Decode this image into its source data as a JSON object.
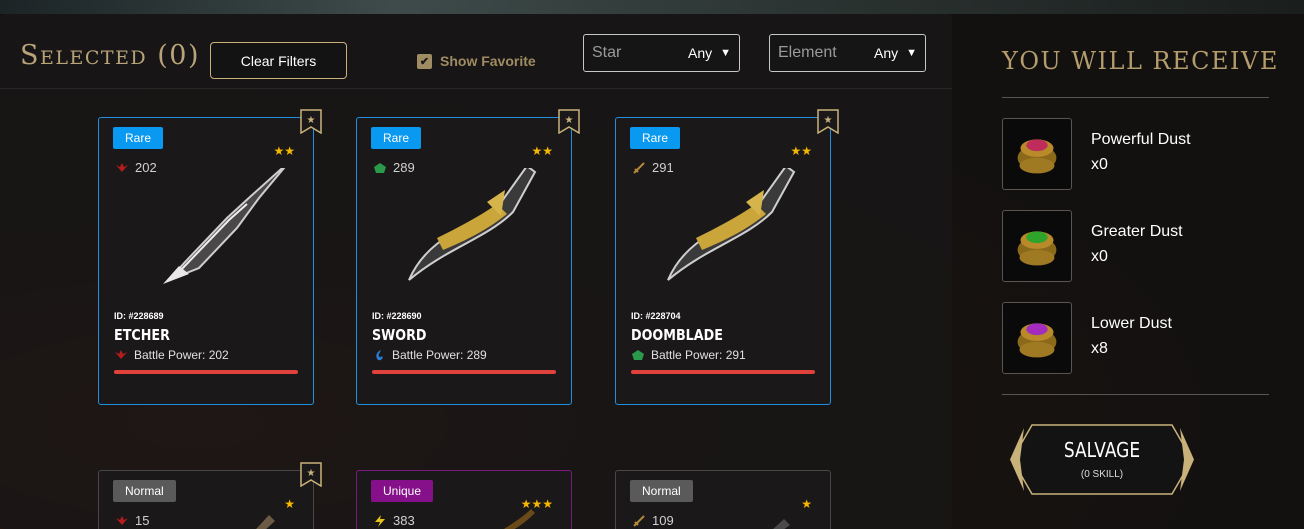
{
  "header": {
    "selected_title": "Selected (0)",
    "clear_filters": "Clear Filters",
    "show_favorite": "Show Favorite",
    "star_filter": {
      "label": "Star",
      "value": "Any"
    },
    "element_filter": {
      "label": "Element",
      "value": "Any"
    }
  },
  "cards": [
    {
      "rarity": "Rare",
      "stars": "★★",
      "power": "202",
      "id": "ID: #228689",
      "name": "ETCHER",
      "battle_power": "Battle Power: 202"
    },
    {
      "rarity": "Rare",
      "stars": "★★",
      "power": "289",
      "id": "ID: #228690",
      "name": "SWORD",
      "battle_power": "Battle Power: 289"
    },
    {
      "rarity": "Rare",
      "stars": "★★",
      "power": "291",
      "id": "ID: #228704",
      "name": "DOOMBLADE",
      "battle_power": "Battle Power: 291"
    },
    {
      "rarity": "Normal",
      "stars": "★",
      "power": "15"
    },
    {
      "rarity": "Unique",
      "stars": "★★★",
      "power": "383"
    },
    {
      "rarity": "Normal",
      "stars": "★",
      "power": "109"
    }
  ],
  "receive": {
    "title": "YOU WILL RECEIVE",
    "items": [
      {
        "name": "Powerful Dust",
        "count": "x0",
        "color": "#c02c5c"
      },
      {
        "name": "Greater Dust",
        "count": "x0",
        "color": "#2ea52a"
      },
      {
        "name": "Lower Dust",
        "count": "x8",
        "color": "#a32cbf"
      }
    ],
    "salvage_label": "SALVAGE",
    "salvage_sub": "(0 SKILL)"
  },
  "colors": {
    "gold": "#c9b27a",
    "rare": "#0a99f0",
    "bar": "#e0413b"
  }
}
